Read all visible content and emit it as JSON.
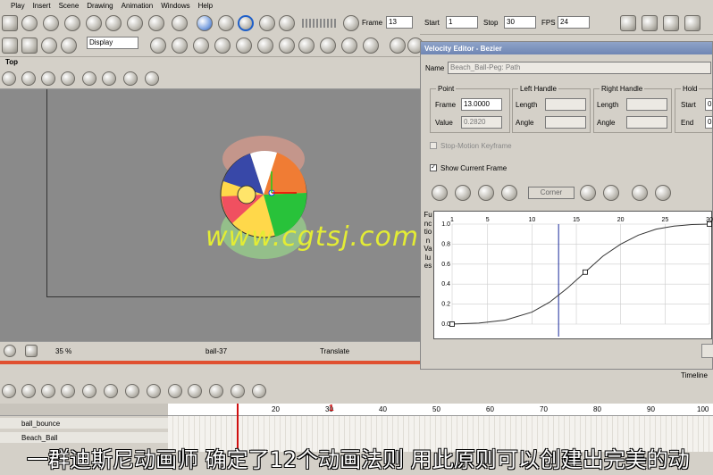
{
  "menu": [
    "Play",
    "Insert",
    "Scene",
    "Drawing",
    "Animation",
    "Windows",
    "Help"
  ],
  "toolbar": {
    "frame_label": "Frame",
    "frame_value": "13",
    "start_label": "Start",
    "start_value": "1",
    "stop_label": "Stop",
    "stop_value": "30",
    "fps_label": "FPS",
    "fps_value": "24",
    "display_value": "Display"
  },
  "view": {
    "tab": "Top",
    "zoom": "35 %",
    "drawing": "ball-37",
    "mode": "Translate"
  },
  "watermark": "www.cgtsj.com",
  "velocity_editor": {
    "title": "Velocity Editor - Bezier",
    "name_label": "Name",
    "name_value": "Beach_Ball-Peg: Path",
    "point": {
      "title": "Point",
      "frame_label": "Frame",
      "frame_value": "13.0000",
      "value_label": "Value",
      "value_value": "0.2820"
    },
    "left_handle": {
      "title": "Left Handle",
      "length": "Length",
      "angle": "Angle"
    },
    "right_handle": {
      "title": "Right Handle",
      "length": "Length",
      "angle": "Angle"
    },
    "hold": {
      "title": "Hold",
      "start": "Start",
      "start_value": "0",
      "end": "End",
      "end_value": "0"
    },
    "stop_motion": "Stop-Motion Keyframe",
    "show_current": "Show Current Frame",
    "corner": "Corner",
    "ylabel": "Function Values"
  },
  "chart_data": {
    "type": "line",
    "ylabel": "Function Values",
    "x_ticks": [
      "1",
      "5",
      "10",
      "15",
      "20",
      "25",
      "30"
    ],
    "y_ticks": [
      "0.0",
      "0.2",
      "0.4",
      "0.6",
      "0.8",
      "1.0"
    ],
    "xlim": [
      1,
      30
    ],
    "ylim": [
      0,
      1
    ],
    "current_frame": 13,
    "x": [
      1,
      4,
      7,
      10,
      12,
      14,
      16,
      18,
      20,
      22,
      24,
      26,
      28,
      30
    ],
    "y": [
      0,
      0.01,
      0.04,
      0.12,
      0.22,
      0.36,
      0.52,
      0.68,
      0.8,
      0.89,
      0.95,
      0.98,
      0.995,
      1.0
    ],
    "keyframes": [
      {
        "x": 1,
        "y": 0
      },
      {
        "x": 16,
        "y": 0.52
      },
      {
        "x": 30,
        "y": 1.0
      }
    ]
  },
  "timeline": {
    "label": "Timeline",
    "layers": [
      "ball_bounce",
      "Beach_Ball"
    ],
    "ruler": [
      "20",
      "30",
      "40",
      "50",
      "60",
      "70",
      "80",
      "90",
      "100"
    ],
    "frame_marker": "1"
  },
  "subtitle": "一群迪斯尼动画师 确定了12个动画法则 用此原则可以创建出完美的动"
}
